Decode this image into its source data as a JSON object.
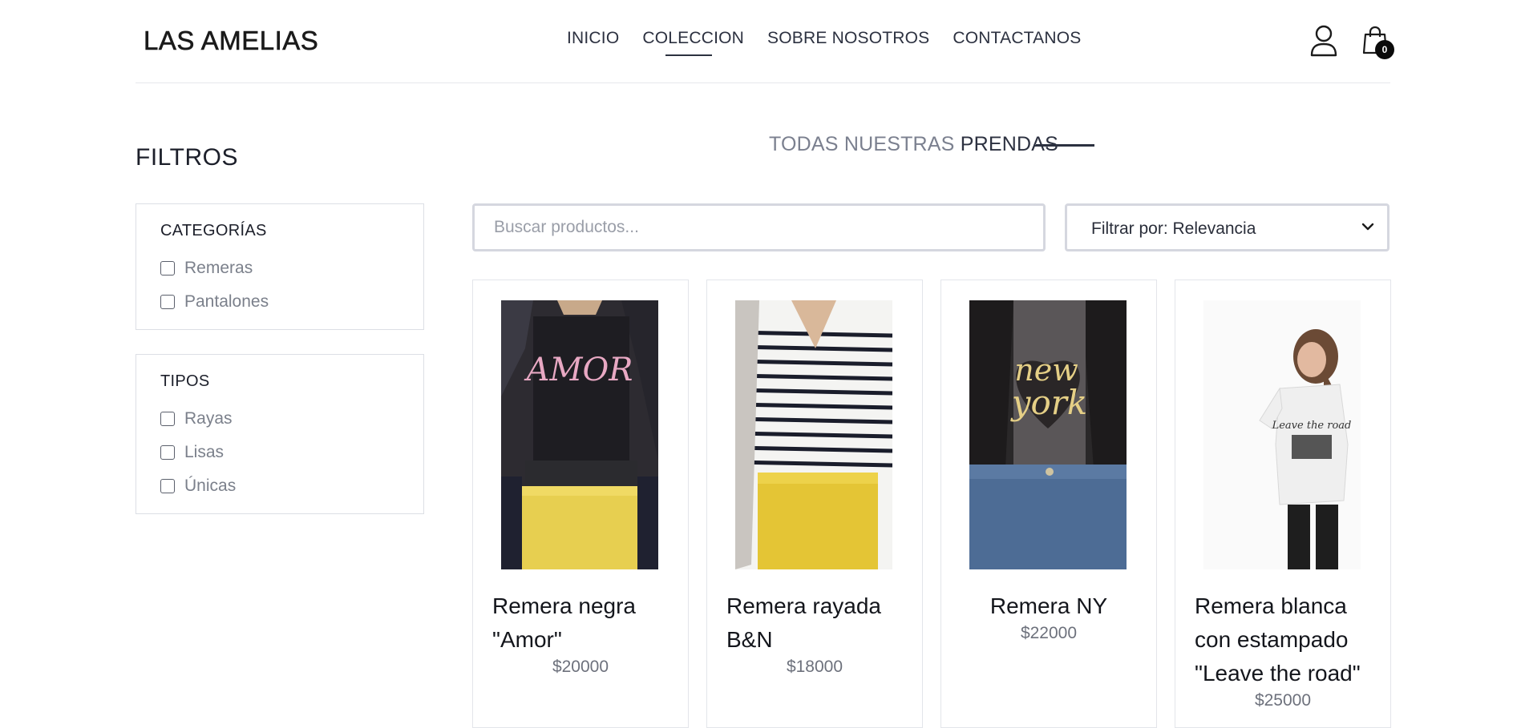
{
  "brand": "LAS AMELIAS",
  "nav": [
    {
      "label": "INICIO"
    },
    {
      "label": "COLECCION"
    },
    {
      "label": "SOBRE NOSOTROS"
    },
    {
      "label": "CONTACTANOS"
    }
  ],
  "cart": {
    "count": "0"
  },
  "icons": {
    "user": "user-icon",
    "cart": "shopping-bag-icon",
    "sort": "chevron-down-icon"
  },
  "sidebar": {
    "title": "FILTROS",
    "categories": {
      "title": "CATEGORÍAS",
      "options": [
        "Remeras",
        "Pantalones"
      ]
    },
    "types": {
      "title": "TIPOS",
      "options": [
        "Rayas",
        "Lisas",
        "Únicas"
      ]
    }
  },
  "main": {
    "title_light": "TODAS NUESTRAS ",
    "title_bold": "PRENDAS",
    "search_placeholder": "Buscar productos...",
    "sort_label": "Filtrar por: Relevancia"
  },
  "products": [
    {
      "name": "Remera negra \"Amor\"",
      "price": "$20000"
    },
    {
      "name": "Remera rayada B&N",
      "price": "$18000"
    },
    {
      "name": "Remera NY",
      "price": "$22000"
    },
    {
      "name": "Remera blanca con estampado \"Leave the road\"",
      "price": "$25000"
    }
  ],
  "colors": {
    "text": "#2c3140",
    "muted": "#7b808b",
    "border": "#dcdfe5",
    "badge": "#0b0b0b"
  }
}
